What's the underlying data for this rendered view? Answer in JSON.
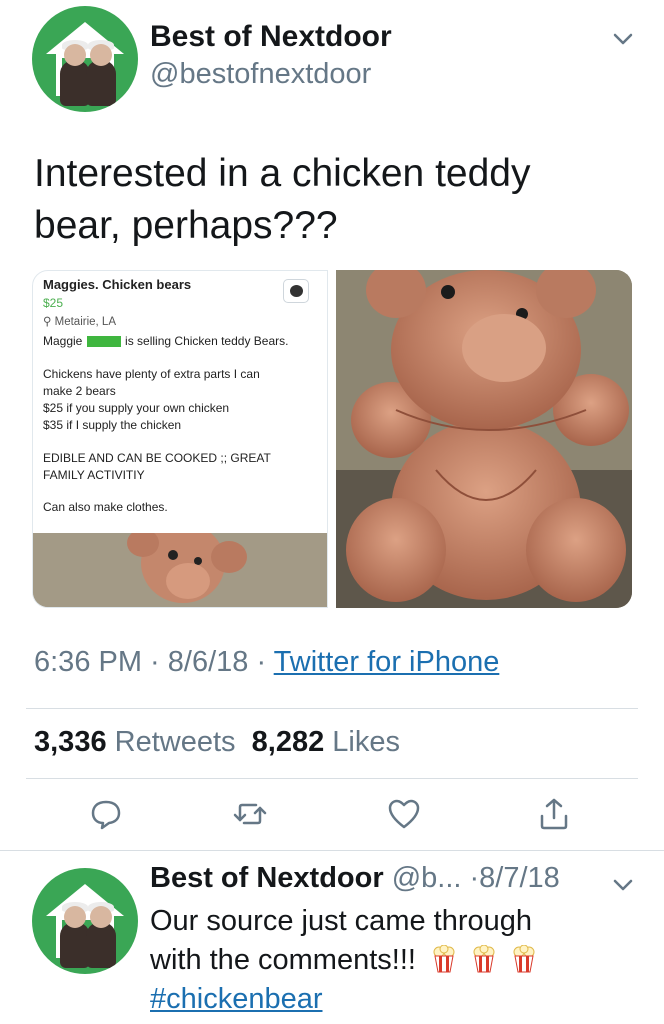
{
  "tweet": {
    "author_name": "Best of Nextdoor",
    "author_handle": "@bestofnextdoor",
    "text": "Interested in a chicken teddy\nbear, perhaps???",
    "time": "6:36 PM",
    "date": "8/6/18",
    "separator": " · ",
    "source": "Twitter for iPhone",
    "retweets_count": "3,336",
    "retweets_label": "Retweets",
    "likes_count": "8,282",
    "likes_label": "Likes"
  },
  "listing": {
    "title": "Maggies. Chicken bears",
    "price": "$25",
    "location": "Metairie, LA",
    "seller_prefix": "Maggie",
    "seller_suffix": "is selling Chicken teddy Bears.",
    "body": "Chickens have plenty of extra parts I can\nmake 2 bears\n$25 if you supply your own chicken\n$35 if I supply the chicken",
    "note": "EDIBLE AND CAN BE COOKED ;; GREAT\nFAMILY ACTIVITIY",
    "extra": "Can also make clothes."
  },
  "actions": [
    "reply-icon",
    "retweet-icon",
    "like-icon",
    "share-icon"
  ],
  "reply": {
    "author_name": "Best of Nextdoor",
    "author_handle": "@b...",
    "date": "·8/7/18",
    "line1": "Our source just came through",
    "line2": "with the comments!!!",
    "hashtag": "#chickenbear"
  },
  "colors": {
    "avatar_green": "#3aa655",
    "link_blue": "#1b6fb0",
    "secondary_text": "#657786",
    "price_green": "#4caf50"
  }
}
